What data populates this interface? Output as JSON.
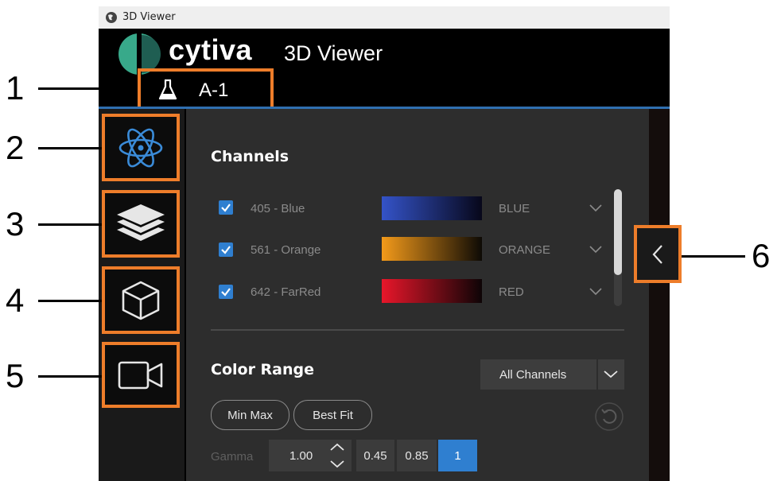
{
  "window": {
    "title": "3D Viewer"
  },
  "header": {
    "brand": "cytiva",
    "app_title": "3D Viewer",
    "sample_name": "A-1"
  },
  "callouts": [
    "1",
    "2",
    "3",
    "4",
    "5",
    "6"
  ],
  "nav": [
    {
      "icon": "atom-icon"
    },
    {
      "icon": "layers-icon"
    },
    {
      "icon": "cube-icon"
    },
    {
      "icon": "video-camera-icon"
    }
  ],
  "channels": {
    "heading": "Channels",
    "items": [
      {
        "checked": true,
        "label": "405 - Blue",
        "color_name": "BLUE",
        "color": "#3453c8"
      },
      {
        "checked": true,
        "label": "561 - Orange",
        "color_name": "ORANGE",
        "color": "#f39a1a"
      },
      {
        "checked": true,
        "label": "642 - FarRed",
        "color_name": "RED",
        "color": "#e8162a"
      }
    ]
  },
  "color_range": {
    "heading": "Color Range",
    "channel_select": "All Channels",
    "buttons": {
      "min_max": "Min Max",
      "best_fit": "Best Fit"
    },
    "gamma_label": "Gamma",
    "gamma_value": "1.00",
    "presets": [
      "0.45",
      "0.85",
      "1"
    ],
    "active_preset": "1"
  },
  "colors": {
    "accent": "#ee7d2a",
    "selected": "#2f7fd0",
    "header_line": "#2f6fb0"
  }
}
